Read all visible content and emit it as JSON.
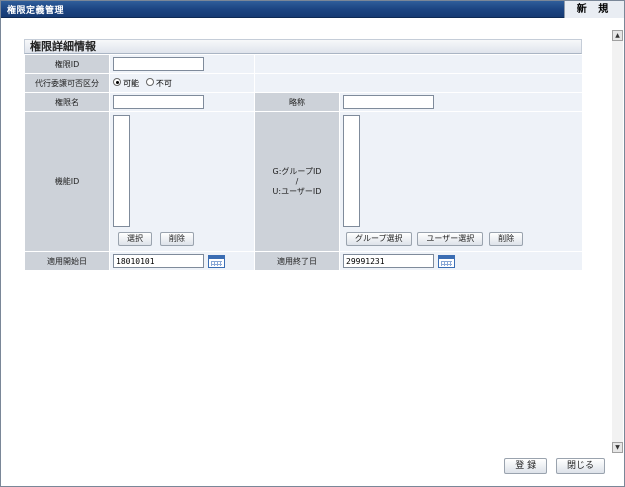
{
  "window": {
    "title": "権限定義管理",
    "new_label": "新 規"
  },
  "section": {
    "title": "権限詳細情報"
  },
  "form": {
    "auth_id": {
      "label": "権限ID",
      "value": ""
    },
    "delegation": {
      "label": "代行委譲可否区分",
      "option_yes": "可能",
      "option_no": "不可",
      "selected": "可能"
    },
    "auth_name": {
      "label": "権限名",
      "value": ""
    },
    "abbrev": {
      "label": "略称",
      "value": ""
    },
    "function_id": {
      "label": "機能ID",
      "select_label": "選択",
      "delete_label": "削除"
    },
    "group_user": {
      "label_line1": "G:グループID",
      "label_line2": "/",
      "label_line3": "U:ユーザーID",
      "group_select_label": "グループ選択",
      "user_select_label": "ユーザー選択",
      "delete_label": "削除"
    },
    "start_date": {
      "label": "適用開始日",
      "value": "18010101"
    },
    "end_date": {
      "label": "適用終了日",
      "value": "29991231"
    }
  },
  "footer": {
    "register_label": "登 録",
    "close_label": "閉じる"
  },
  "colors": {
    "titlebar": "#1c4583",
    "label_bg": "#cdd2d9",
    "value_bg": "#eef2f8"
  }
}
